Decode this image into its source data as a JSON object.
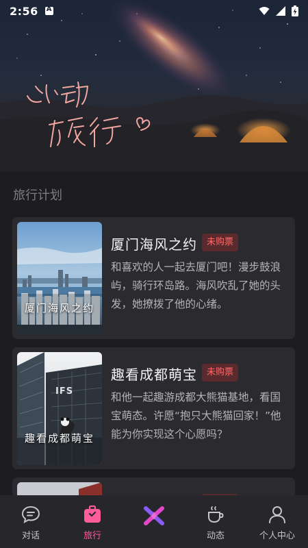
{
  "status_bar": {
    "time": "2:56"
  },
  "hero": {
    "line1": "心动",
    "line2": "旅行"
  },
  "section": {
    "title": "旅行计划"
  },
  "trips": [
    {
      "title": "厦门海风之约",
      "badge": "未购票",
      "description": "和喜欢的人一起去厦门吧！漫步鼓浪屿，骑行环岛路。海风吹乱了她的头发，她撩拨了他的心绪。",
      "image_caption": "厦门海风之约"
    },
    {
      "title": "趣看成都萌宝",
      "badge": "未购票",
      "description": "和他一起趣游成都大熊猫基地，看国宝萌态。许愿“抱只大熊猫回家！”他能为你实现这个心愿吗？",
      "image_caption": "趣看成都萌宝",
      "image_sign": "IFS"
    }
  ],
  "nav": {
    "items": [
      {
        "label": "对话",
        "icon": "chat-icon",
        "active": false
      },
      {
        "label": "旅行",
        "icon": "suitcase-icon",
        "active": true
      },
      {
        "label": "",
        "icon": "x-logo-icon",
        "active": false
      },
      {
        "label": "动态",
        "icon": "coffee-cup-icon",
        "active": false
      },
      {
        "label": "个人中心",
        "icon": "person-icon",
        "active": false
      }
    ]
  },
  "colors": {
    "accent": "#ff5c9a",
    "badge_text": "#ff6b6b",
    "badge_bg": "#5a2a2d",
    "background": "#1d1d21",
    "card": "#2a2a2f"
  }
}
